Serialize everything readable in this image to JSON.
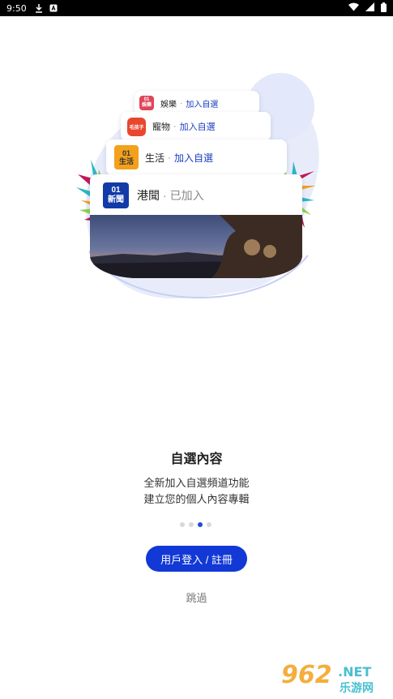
{
  "status_bar": {
    "time": "9:50"
  },
  "cards": [
    {
      "logo_text": "01\n娛樂",
      "name": "娛樂",
      "dot": "·",
      "action": "加入自選",
      "logo_color": "#e0455a"
    },
    {
      "logo_text": "毛孩子",
      "name": "寵物",
      "dot": "·",
      "action": "加入自選",
      "logo_color": "#e8462e"
    },
    {
      "logo_text": "01\n生活",
      "name": "生活",
      "dot": "·",
      "action": "加入自選",
      "logo_color": "#f3a01b"
    },
    {
      "logo_text": "01\n新聞",
      "name": "港聞",
      "dot": "·",
      "action": "已加入",
      "logo_color": "#123aa8"
    }
  ],
  "onboarding": {
    "title": "自選內容",
    "desc_line1": "全新加入自選頻道功能",
    "desc_line2": "建立您的個人內容專輯",
    "page_count": 4,
    "active_page": 3
  },
  "login_button": "用戶登入 / 註冊",
  "skip_link": "跳過",
  "watermark": {
    "brand": "962",
    "net": ".NET",
    "sub": "乐游网"
  },
  "colors": {
    "accent": "#1238d6",
    "blob": "#e6ebfa"
  }
}
